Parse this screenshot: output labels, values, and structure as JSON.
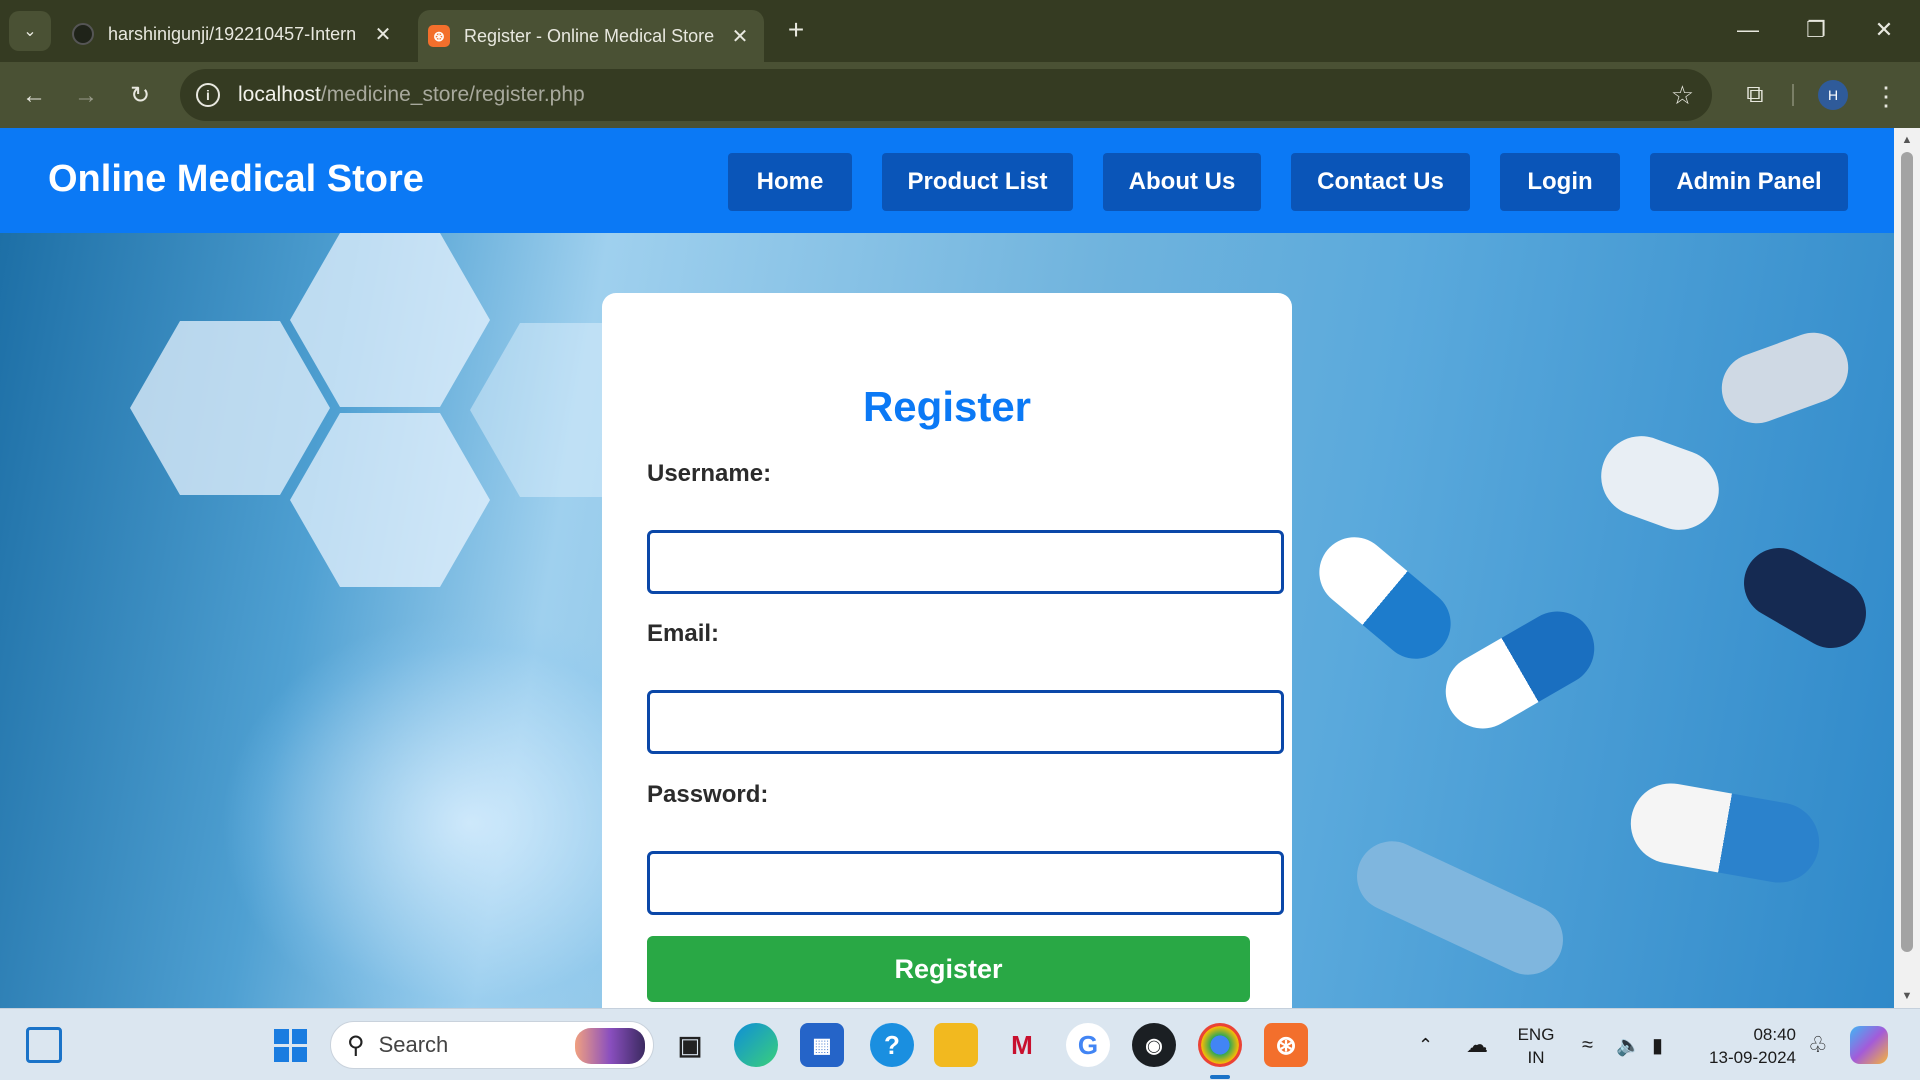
{
  "browser": {
    "tabs": [
      {
        "title": "harshinigunji/192210457-Intern",
        "active": false
      },
      {
        "title": "Register - Online Medical Store",
        "active": true
      }
    ],
    "address": {
      "host": "localhost",
      "path": "/medicine_store/register.php"
    },
    "profile_initial": "H"
  },
  "site": {
    "brand": "Online Medical Store",
    "nav": [
      "Home",
      "Product List",
      "About Us",
      "Contact Us",
      "Login",
      "Admin Panel"
    ]
  },
  "form": {
    "heading": "Register",
    "username_label": "Username:",
    "username_value": "",
    "email_label": "Email:",
    "email_value": "",
    "password_label": "Password:",
    "password_value": "",
    "submit_label": "Register"
  },
  "taskbar": {
    "search_text": "Search",
    "language": {
      "line1": "ENG",
      "line2": "IN"
    },
    "time": "08:40",
    "date": "13-09-2024"
  },
  "colors": {
    "header_blue": "#0b79f5",
    "nav_button": "#0a55b8",
    "submit_green": "#29a845",
    "input_border": "#0a47a8"
  }
}
